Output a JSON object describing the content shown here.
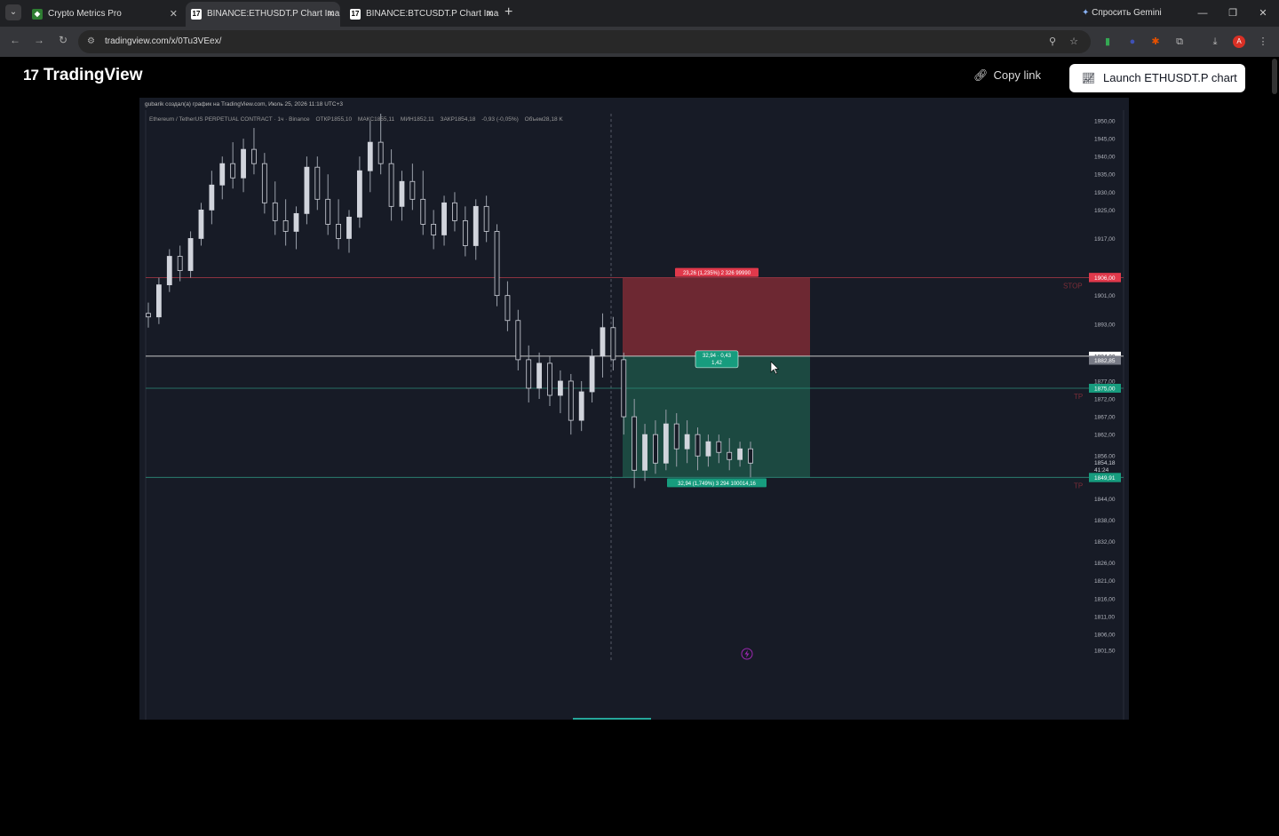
{
  "browser": {
    "tabs": [
      {
        "title": "Crypto Metrics Pro",
        "icon": "green-square-icon",
        "active": false
      },
      {
        "title": "BINANCE:ETHUSDT.P Chart Ima",
        "icon": "tradingview-icon",
        "active": true
      },
      {
        "title": "BINANCE:BTCUSDT.P Chart Ima",
        "icon": "tradingview-icon",
        "active": false
      }
    ],
    "gemini_label": "Спросить Gemini",
    "url": "tradingview.com/x/0Tu3VEex/"
  },
  "header": {
    "logo_text": "TradingView",
    "copy_link_label": "Copy link",
    "launch_label": "Launch ETHUSDT.P chart"
  },
  "chart": {
    "creator_line": "gubarik создал(а) график на TradingView.com, Июль 25, 2026 11:18 UTC+3",
    "legend": {
      "symbol": "Ethereum / TetherUS PERPETUAL CONTRACT · 1ч · Binance",
      "open": "ОТКР1855,10",
      "high": "МАКС1855,11",
      "low": "МИН1852,11",
      "close": "ЗАКР1854,18",
      "change": "-0,93 (-0,05%)",
      "volume": "Объем28,18 K"
    },
    "colors": {
      "background": "#171b26",
      "up": "#d1d4dc",
      "stop_zone": "#7c2a35",
      "target_zone": "#1d4f45",
      "red_label": "#e0394b",
      "green_label": "#179c7e"
    }
  },
  "chart_data": {
    "type": "candlestick",
    "position_tool": {
      "stop_label": "23,26 (1,235%) 2 326 99990",
      "entry_label_line1": "32,94 · 0,43",
      "entry_label_line2": "1,42",
      "target_label": "32,94 (1,749%) 3 294 100014,16",
      "stop_tag": "STOP",
      "tp_tags": [
        "TP",
        "TP"
      ]
    },
    "yaxis": {
      "ticks": [
        "1950,00",
        "1945,00",
        "1940,00",
        "1935,00",
        "1930,00",
        "1925,00",
        "1917,00",
        "1901,00",
        "1893,00",
        "1877,00",
        "1872,00",
        "1867,00",
        "1862,00",
        "1856,00",
        "1844,00",
        "1838,00",
        "1832,00",
        "1826,00",
        "1821,00",
        "1816,00",
        "1811,00",
        "1806,00",
        "1801,50"
      ],
      "tick_values": [
        1950,
        1945,
        1940,
        1935,
        1930,
        1925,
        1917,
        1901,
        1893,
        1877,
        1872,
        1867,
        1862,
        1856,
        1844,
        1838,
        1832,
        1826,
        1821,
        1816,
        1811,
        1806,
        1801.5
      ],
      "range": [
        1797,
        1952
      ]
    },
    "price_tags": [
      {
        "label": "1906,11",
        "value": 1906.11,
        "kind": "red"
      },
      {
        "label": "1906,00",
        "value": 1906.0,
        "kind": "red"
      },
      {
        "label": "1884,00",
        "value": 1884.0,
        "kind": "white"
      },
      {
        "label": "1882,85",
        "value": 1882.85,
        "kind": "gray"
      },
      {
        "label": "1875,00",
        "value": 1875.0,
        "kind": "green"
      },
      {
        "label": "1854,18",
        "value": 1854.18,
        "kind": "dark"
      },
      {
        "label": "41:24",
        "value": 1852.2,
        "kind": "dark"
      },
      {
        "label": "1850,00",
        "value": 1850.0,
        "kind": "green"
      },
      {
        "label": "1849,91",
        "value": 1849.91,
        "kind": "green"
      }
    ],
    "levels": {
      "stop": 1906,
      "entry": 1884,
      "tp1": 1875,
      "tp2": 1850
    },
    "candles": [
      [
        1896,
        1899,
        1892,
        1895
      ],
      [
        1895,
        1906,
        1893,
        1904
      ],
      [
        1904,
        1914,
        1902,
        1912
      ],
      [
        1912,
        1915,
        1905,
        1908
      ],
      [
        1908,
        1919,
        1906,
        1917
      ],
      [
        1917,
        1927,
        1915,
        1925
      ],
      [
        1925,
        1936,
        1921,
        1932
      ],
      [
        1932,
        1940,
        1928,
        1938
      ],
      [
        1938,
        1944,
        1931,
        1934
      ],
      [
        1934,
        1945,
        1930,
        1942
      ],
      [
        1942,
        1948,
        1935,
        1938
      ],
      [
        1938,
        1941,
        1924,
        1927
      ],
      [
        1927,
        1933,
        1918,
        1922
      ],
      [
        1922,
        1928,
        1915,
        1919
      ],
      [
        1919,
        1926,
        1914,
        1924
      ],
      [
        1924,
        1940,
        1921,
        1937
      ],
      [
        1937,
        1940,
        1925,
        1928
      ],
      [
        1928,
        1935,
        1918,
        1921
      ],
      [
        1921,
        1928,
        1914,
        1917
      ],
      [
        1917,
        1925,
        1913,
        1923
      ],
      [
        1923,
        1940,
        1920,
        1936
      ],
      [
        1936,
        1950,
        1930,
        1944
      ],
      [
        1944,
        1952,
        1935,
        1938
      ],
      [
        1938,
        1942,
        1922,
        1926
      ],
      [
        1926,
        1936,
        1922,
        1933
      ],
      [
        1933,
        1938,
        1925,
        1928
      ],
      [
        1928,
        1936,
        1918,
        1921
      ],
      [
        1921,
        1925,
        1914,
        1918
      ],
      [
        1918,
        1929,
        1915,
        1927
      ],
      [
        1927,
        1930,
        1919,
        1922
      ],
      [
        1922,
        1926,
        1912,
        1915
      ],
      [
        1915,
        1928,
        1911,
        1926
      ],
      [
        1926,
        1929,
        1916,
        1919
      ],
      [
        1919,
        1921,
        1898,
        1901
      ],
      [
        1901,
        1905,
        1891,
        1894
      ],
      [
        1894,
        1897,
        1880,
        1883
      ],
      [
        1883,
        1887,
        1871,
        1875
      ],
      [
        1875,
        1885,
        1872,
        1882
      ],
      [
        1882,
        1884,
        1870,
        1873
      ],
      [
        1873,
        1880,
        1868,
        1877
      ],
      [
        1877,
        1879,
        1862,
        1866
      ],
      [
        1866,
        1877,
        1863,
        1874
      ],
      [
        1874,
        1886,
        1871,
        1884
      ],
      [
        1884,
        1896,
        1878,
        1892
      ],
      [
        1892,
        1895,
        1880,
        1883
      ],
      [
        1883,
        1885,
        1862,
        1867
      ],
      [
        1867,
        1872,
        1847,
        1852
      ],
      [
        1852,
        1865,
        1849,
        1862
      ],
      [
        1862,
        1866,
        1851,
        1854
      ],
      [
        1854,
        1869,
        1852,
        1865
      ],
      [
        1865,
        1868,
        1853,
        1858
      ],
      [
        1858,
        1866,
        1854,
        1862
      ],
      [
        1862,
        1864,
        1852,
        1856
      ],
      [
        1856,
        1862,
        1853,
        1860
      ],
      [
        1860,
        1862,
        1854,
        1857
      ],
      [
        1857,
        1861,
        1852,
        1855
      ],
      [
        1855,
        1860,
        1853,
        1858
      ],
      [
        1858,
        1860,
        1850,
        1854
      ]
    ]
  }
}
